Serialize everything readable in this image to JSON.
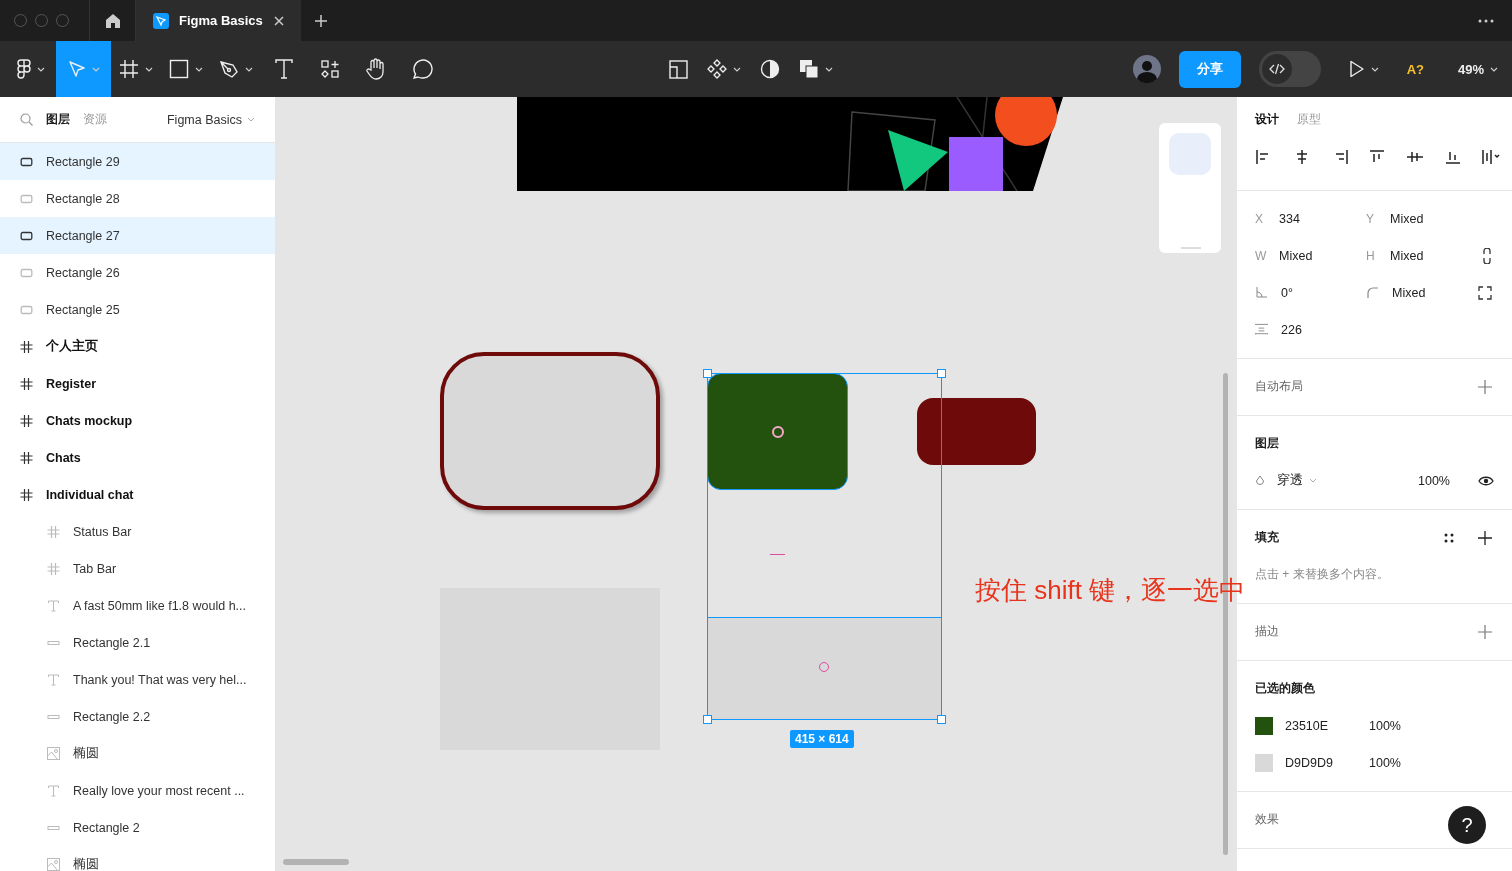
{
  "window": {
    "tabs": [
      {
        "label": "Figma Basics",
        "selected": true
      }
    ]
  },
  "toolbar": {
    "tools": [
      {
        "kind": "main-menu",
        "selected": false,
        "has_menu": true
      },
      {
        "kind": "move",
        "selected": true,
        "has_menu": true
      },
      {
        "kind": "frame",
        "selected": false,
        "has_menu": true
      },
      {
        "kind": "rectangle",
        "selected": false,
        "has_menu": true
      },
      {
        "kind": "pen",
        "selected": false,
        "has_menu": true
      },
      {
        "kind": "text",
        "selected": false,
        "has_menu": false
      },
      {
        "kind": "resources",
        "selected": false,
        "has_menu": false
      },
      {
        "kind": "hand",
        "selected": false,
        "has_menu": false
      },
      {
        "kind": "comment",
        "selected": false,
        "has_menu": false
      }
    ],
    "center_tools": [
      {
        "kind": "layout",
        "has_menu": false
      },
      {
        "kind": "component",
        "has_menu": true
      },
      {
        "kind": "mask",
        "has_menu": false
      },
      {
        "kind": "boolean",
        "has_menu": true
      }
    ],
    "share_label": "分享",
    "dev_mode": false,
    "font_check": "A?",
    "zoom": "49%"
  },
  "layers_panel": {
    "tabs": [
      {
        "label": "图层",
        "selected": true
      },
      {
        "label": "资源",
        "selected": false
      }
    ],
    "page": "Figma Basics",
    "layers": [
      {
        "name": "Rectangle 29",
        "kind": "rectangle",
        "selected": true
      },
      {
        "name": "Rectangle 28",
        "kind": "rectangle",
        "selected": false
      },
      {
        "name": "Rectangle 27",
        "kind": "rectangle",
        "selected": true
      },
      {
        "name": "Rectangle 26",
        "kind": "rectangle",
        "selected": false
      },
      {
        "name": "Rectangle 25",
        "kind": "rectangle",
        "selected": false
      },
      {
        "name": "个人主页",
        "kind": "frame",
        "selected": false
      },
      {
        "name": "Register",
        "kind": "frame",
        "selected": false
      },
      {
        "name": "Chats mockup",
        "kind": "frame",
        "selected": false
      },
      {
        "name": "Chats",
        "kind": "frame",
        "selected": false
      },
      {
        "name": "Individual chat",
        "kind": "frame",
        "selected": false,
        "children": [
          {
            "name": "Status Bar",
            "kind": "frame",
            "selected": false
          },
          {
            "name": "Tab Bar",
            "kind": "frame",
            "selected": false
          },
          {
            "name": "A fast 50mm like f1.8 would h...",
            "kind": "text",
            "selected": false
          },
          {
            "name": "Rectangle 2.1",
            "kind": "line",
            "selected": false
          },
          {
            "name": "Thank you! That was very hel...",
            "kind": "text",
            "selected": false
          },
          {
            "name": "Rectangle 2.2",
            "kind": "line",
            "selected": false
          },
          {
            "name": "椭圆",
            "kind": "image",
            "selected": false
          },
          {
            "name": "Really love your most recent ...",
            "kind": "text",
            "selected": false
          },
          {
            "name": "Rectangle 2",
            "kind": "line",
            "selected": false
          },
          {
            "name": "椭圆",
            "kind": "image",
            "selected": false
          }
        ]
      }
    ]
  },
  "canvas": {
    "selection_size": "415 × 614",
    "annotation": "按住 shift 键，逐一选中"
  },
  "design_panel": {
    "tabs": [
      {
        "label": "设计",
        "selected": true
      },
      {
        "label": "原型",
        "selected": false
      }
    ],
    "align_tools": [
      {
        "kind": "left"
      },
      {
        "kind": "hcenter"
      },
      {
        "kind": "right"
      },
      {
        "kind": "top"
      },
      {
        "kind": "vcenter"
      },
      {
        "kind": "bottom"
      },
      {
        "kind": "distribute"
      }
    ],
    "properties": [
      {
        "kind": "plain",
        "fields": [
          {
            "kind": "letter",
            "label": "X",
            "value": "334"
          },
          {
            "kind": "letter",
            "label": "Y",
            "value": "Mixed"
          }
        ]
      },
      {
        "kind": "link",
        "fields": [
          {
            "kind": "letter",
            "label": "W",
            "value": "Mixed"
          },
          {
            "kind": "letter",
            "label": "H",
            "value": "Mixed"
          }
        ]
      },
      {
        "kind": "corners",
        "fields": [
          {
            "kind": "rotation",
            "value": "0°"
          },
          {
            "kind": "radius",
            "value": "Mixed"
          }
        ]
      },
      {
        "kind": "plain",
        "fields": [
          {
            "kind": "spacing",
            "value": "226"
          }
        ]
      }
    ],
    "auto_layout": {
      "title": "自动布局"
    },
    "layer": {
      "title": "图层",
      "blend": "穿透",
      "opacity": "100%",
      "visible": true
    },
    "fill": {
      "title": "填充",
      "hint": "点击 + 来替换多个内容。"
    },
    "stroke": {
      "title": "描边"
    },
    "selection_colors": {
      "title": "已选的颜色",
      "colors": [
        {
          "color": "#23510e",
          "hex": "23510E",
          "opacity": "100%"
        },
        {
          "color": "#d9d9d9",
          "hex": "D9D9D9",
          "opacity": "100%"
        }
      ]
    },
    "effects": {
      "title": "效果"
    }
  },
  "help": "?"
}
